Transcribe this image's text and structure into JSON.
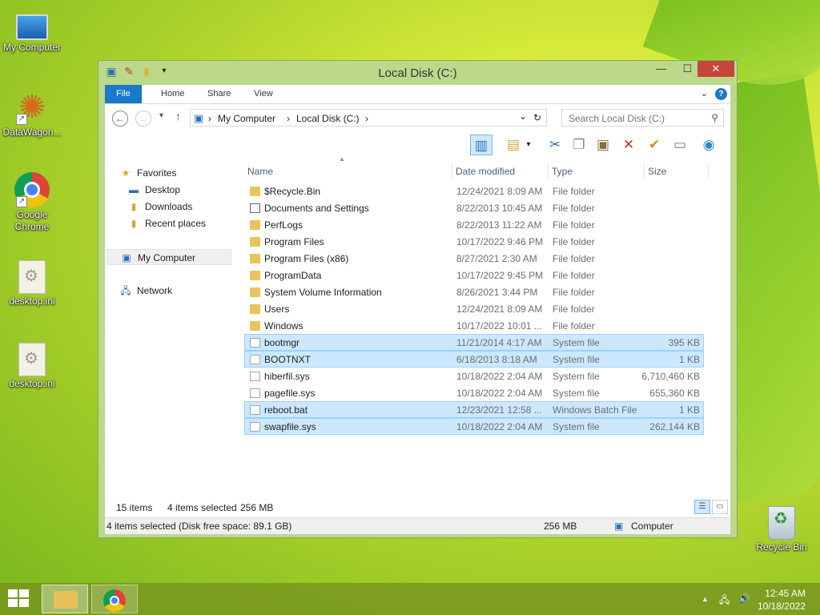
{
  "desktop": {
    "icons": [
      {
        "label": "My Computer"
      },
      {
        "label": "DataWagon..."
      },
      {
        "label": "Google Chrome"
      },
      {
        "label": "desktop.ini"
      },
      {
        "label": "desktop.ini"
      },
      {
        "label": "Recycle Bin"
      }
    ]
  },
  "window": {
    "title": "Local Disk (C:)",
    "minimize": "—",
    "maximize": "☐",
    "close": "✕"
  },
  "ribbon": {
    "tabs": [
      "File",
      "Home",
      "Share",
      "View"
    ],
    "collapse": "⌄",
    "help": "?"
  },
  "address": {
    "back": "←",
    "forward": "→",
    "recent": "▾",
    "up": "↑",
    "crumbs": [
      "My Computer",
      "Local Disk (C:)"
    ],
    "separator": "›",
    "refresh": "↻",
    "dropdown": "⌄",
    "search_placeholder": "Search Local Disk (C:)"
  },
  "toolbar": {
    "icons": [
      "preview-pane-icon",
      "properties-icon",
      "cut-icon",
      "copy-icon",
      "paste-icon",
      "delete-icon",
      "check-icon",
      "rename-icon",
      "globe-icon"
    ]
  },
  "nav": {
    "favorites": "Favorites",
    "desktop": "Desktop",
    "downloads": "Downloads",
    "recent": "Recent places",
    "my_computer": "My Computer",
    "network": "Network"
  },
  "columns": {
    "name": "Name",
    "date": "Date modified",
    "type": "Type",
    "size": "Size"
  },
  "files": [
    {
      "name": "$Recycle.Bin",
      "date": "12/24/2021 8:09 AM",
      "type": "File folder",
      "size": "",
      "kind": "folder",
      "selected": false
    },
    {
      "name": "Documents and Settings",
      "date": "8/22/2013 10:45 AM",
      "type": "File folder",
      "size": "",
      "kind": "link",
      "selected": false
    },
    {
      "name": "PerfLogs",
      "date": "8/22/2013 11:22 AM",
      "type": "File folder",
      "size": "",
      "kind": "folder",
      "selected": false
    },
    {
      "name": "Program Files",
      "date": "10/17/2022 9:46 PM",
      "type": "File folder",
      "size": "",
      "kind": "folder",
      "selected": false
    },
    {
      "name": "Program Files (x86)",
      "date": "8/27/2021 2:30 AM",
      "type": "File folder",
      "size": "",
      "kind": "folder",
      "selected": false
    },
    {
      "name": "ProgramData",
      "date": "10/17/2022 9:45 PM",
      "type": "File folder",
      "size": "",
      "kind": "folder",
      "selected": false
    },
    {
      "name": "System Volume Information",
      "date": "8/26/2021 3:44 PM",
      "type": "File folder",
      "size": "",
      "kind": "folder",
      "selected": false
    },
    {
      "name": "Users",
      "date": "12/24/2021 8:09 AM",
      "type": "File folder",
      "size": "",
      "kind": "folder",
      "selected": false
    },
    {
      "name": "Windows",
      "date": "10/17/2022 10:01 ...",
      "type": "File folder",
      "size": "",
      "kind": "folder",
      "selected": false
    },
    {
      "name": "bootmgr",
      "date": "11/21/2014 4:17 AM",
      "type": "System file",
      "size": "395 KB",
      "kind": "file",
      "selected": true
    },
    {
      "name": "BOOTNXT",
      "date": "6/18/2013 8:18 AM",
      "type": "System file",
      "size": "1 KB",
      "kind": "file",
      "selected": true
    },
    {
      "name": "hiberfil.sys",
      "date": "10/18/2022 2:04 AM",
      "type": "System file",
      "size": "6,710,460 KB",
      "kind": "file",
      "selected": false
    },
    {
      "name": "pagefile.sys",
      "date": "10/18/2022 2:04 AM",
      "type": "System file",
      "size": "655,360 KB",
      "kind": "file",
      "selected": false
    },
    {
      "name": "reboot.bat",
      "date": "12/23/2021 12:58 ...",
      "type": "Windows Batch File",
      "size": "1 KB",
      "kind": "file",
      "selected": true
    },
    {
      "name": "swapfile.sys",
      "date": "10/18/2022 2:04 AM",
      "type": "System file",
      "size": "262,144 KB",
      "kind": "file",
      "selected": true
    }
  ],
  "status": {
    "count": "15 items",
    "selected": "4 items selected",
    "size": "256 MB",
    "bottom_left": "4 items selected (Disk free space: 89.1 GB)",
    "bottom_size": "256 MB",
    "bottom_location": "Computer"
  },
  "taskbar": {
    "time": "12:45 AM",
    "date": "10/18/2022",
    "tray_chevron": "▲",
    "tray_network": "🖧",
    "tray_volume": "🔊"
  },
  "colors": {
    "accent": "#1979ca",
    "selection": "#cce8ff",
    "close": "#c7463c"
  }
}
